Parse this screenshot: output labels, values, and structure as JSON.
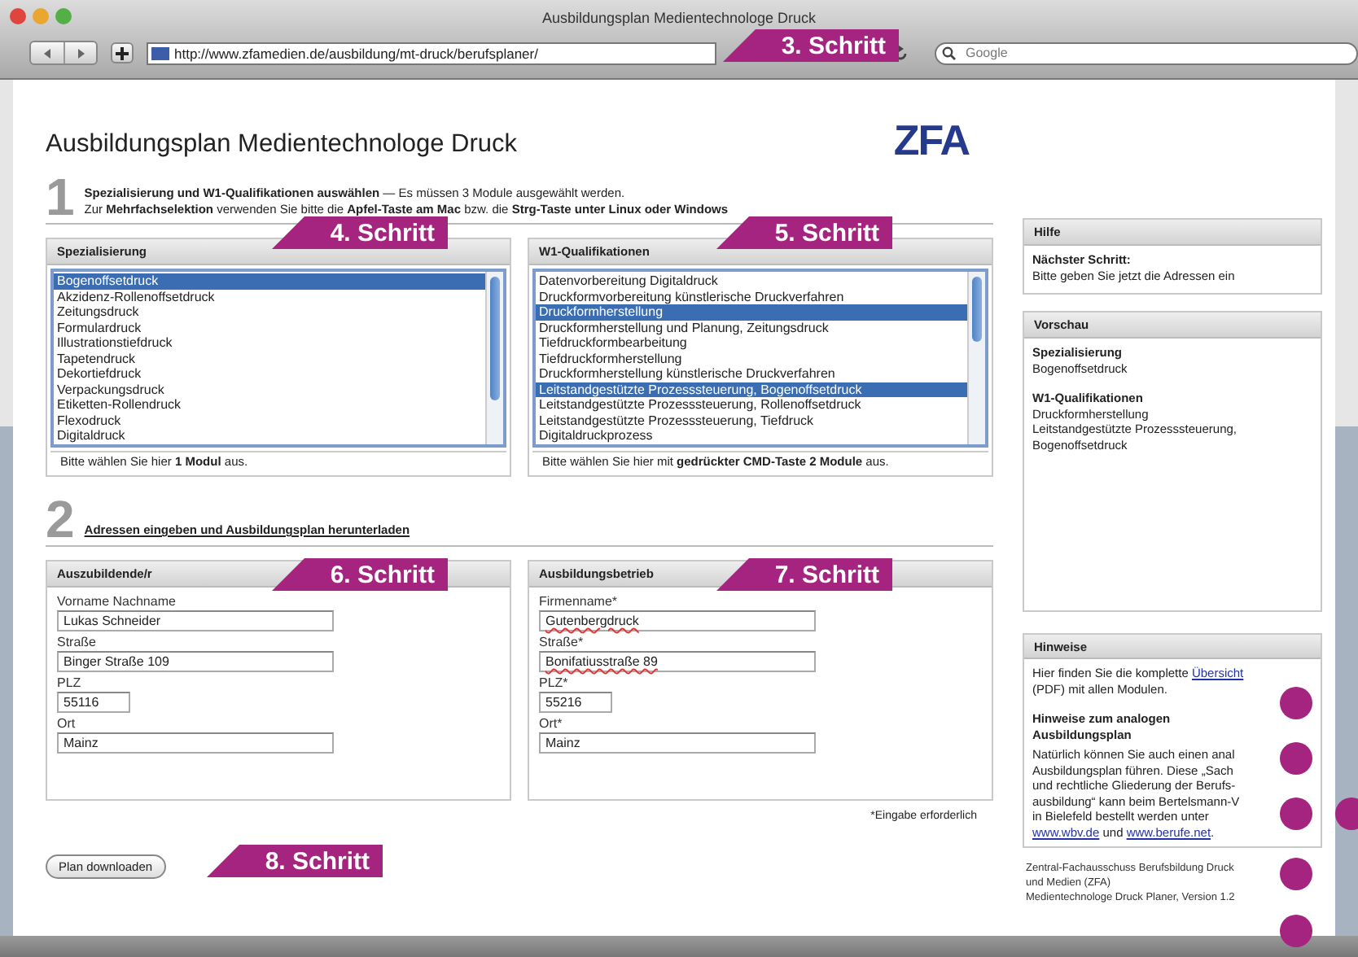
{
  "browser": {
    "title": "Ausbildungsplan Medientechnologe Druck",
    "url": "http://www.zfamedien.de/ausbildung/mt-druck/berufsplaner/",
    "search_placeholder": "Google"
  },
  "page": {
    "heading": "Ausbildungsplan Medientechnologe Druck",
    "logo": "ZFA"
  },
  "step1": {
    "number": "1",
    "intro": "**Spezialisierung und W1-Qualifikationen auswählen** — Es müssen 3 Module ausgewählt werden.",
    "hint": "Zur **Mehrfachselektion** verwenden Sie bitte die **Apfel-Taste am Mac** bzw. die **Strg-Taste unter Linux oder Windows**"
  },
  "lists": [
    {
      "title": "Spezialisierung",
      "note": "Bitte wählen Sie hier **1 Modul** aus.",
      "items": [
        {
          "label": "Bogenoffsetdruck",
          "selected": true
        },
        {
          "label": "Akzidenz-Rollenoffsetdruck",
          "selected": false
        },
        {
          "label": "Zeitungsdruck",
          "selected": false
        },
        {
          "label": "Formulardruck",
          "selected": false
        },
        {
          "label": "Illustrationstiefdruck",
          "selected": false
        },
        {
          "label": "Tapetendruck",
          "selected": false
        },
        {
          "label": "Dekortiefdruck",
          "selected": false
        },
        {
          "label": "Verpackungsdruck",
          "selected": false
        },
        {
          "label": "Etiketten-Rollendruck",
          "selected": false
        },
        {
          "label": "Flexodruck",
          "selected": false
        },
        {
          "label": "Digitaldruck",
          "selected": false
        }
      ]
    },
    {
      "title": "W1-Qualifikationen",
      "note": "Bitte wählen Sie hier mit **gedrückter CMD-Taste 2 Module** aus.",
      "items": [
        {
          "label": "Datenvorbereitung Digitaldruck",
          "selected": false
        },
        {
          "label": "Druckformvorbereitung künstlerische Druckverfahren",
          "selected": false
        },
        {
          "label": "Druckformherstellung",
          "selected": true
        },
        {
          "label": "Druckformherstellung und Planung, Zeitungsdruck",
          "selected": false
        },
        {
          "label": "Tiefdruckformbearbeitung",
          "selected": false
        },
        {
          "label": "Tiefdruckformherstellung",
          "selected": false
        },
        {
          "label": "Druckformherstellung künstlerische Druckverfahren",
          "selected": false
        },
        {
          "label": "Leitstandgestützte Prozesssteuerung, Bogenoffsetdruck",
          "selected": true
        },
        {
          "label": "Leitstandgestützte Prozesssteuerung, Rollenoffsetdruck",
          "selected": false
        },
        {
          "label": "Leitstandgestützte Prozesssteuerung, Tiefdruck",
          "selected": false
        },
        {
          "label": "Digitaldruckprozess",
          "selected": false
        }
      ]
    }
  ],
  "step2": {
    "number": "2",
    "heading": "Adressen eingeben und Ausbildungsplan herunterladen"
  },
  "address_panels": [
    {
      "title": "Auszubildende/r",
      "fields": [
        {
          "label": "Vorname Nachname",
          "value": "Lukas Schneider",
          "misspelled": false,
          "kind": "wide"
        },
        {
          "label": "Straße",
          "value": "Binger Straße 109",
          "misspelled": false,
          "kind": "wide"
        },
        {
          "label": "PLZ",
          "value": "55116",
          "misspelled": false,
          "kind": "short"
        },
        {
          "label": "Ort",
          "value": "Mainz",
          "misspelled": false,
          "kind": "wide"
        }
      ]
    },
    {
      "title": "Ausbildungsbetrieb",
      "fields": [
        {
          "label": "Firmenname*",
          "value": "Gutenbergdruck",
          "misspelled": true,
          "kind": "wide"
        },
        {
          "label": "Straße*",
          "value": "Bonifatiusstraße 89",
          "misspelled": true,
          "kind": "wide"
        },
        {
          "label": "PLZ*",
          "value": "55216",
          "misspelled": false,
          "kind": "short"
        },
        {
          "label": "Ort*",
          "value": "Mainz",
          "misspelled": false,
          "kind": "wide"
        }
      ]
    }
  ],
  "required_note": "*Eingabe erforderlich",
  "download_button": "Plan downloaden",
  "sidebar": {
    "help": {
      "title": "Hilfe",
      "subtitle": "Nächster Schritt:",
      "text": "Bitte geben Sie jetzt die Adressen ein"
    },
    "preview": {
      "title": "Vorschau",
      "sections": [
        {
          "heading": "Spezialisierung",
          "lines": [
            "Bogenoffsetdruck"
          ]
        },
        {
          "heading": "W1-Qualifikationen",
          "lines": [
            "Druckformherstellung",
            "Leitstandgestützte Prozesssteuerung, Bogenoffsetdruck"
          ]
        }
      ]
    },
    "notes": {
      "title": "Hinweise",
      "intro_before": "Hier finden Sie die komplette",
      "intro_link": "Übersicht",
      "intro_after": "(PDF) mit allen Modulen.",
      "subheading": "Hinweise zum analogen Ausbildungsplan",
      "lines": [
        "Natürlich können Sie auch einen anal",
        "Ausbildungsplan führen. Diese „Sach",
        "und rechtliche Gliederung der Berufs-",
        "ausbildung“ kann beim Bertelsmann-V",
        "in Bielefeld bestellt werden unter"
      ],
      "closing": [
        {
          "text": "www.wbv.de",
          "kind": "link"
        },
        {
          "text": " und ",
          "kind": "text"
        },
        {
          "text": "www.berufe.net",
          "kind": "link"
        },
        {
          "text": ".",
          "kind": "text"
        }
      ]
    },
    "footer": [
      "Zentral-Fachausschuss Berufsbildung Druck und Medien (ZFA)",
      "Medientechnologe Druck Planer, Version 1.2"
    ]
  },
  "step_tags": [
    {
      "label": "3. Schritt"
    },
    {
      "label": "4. Schritt"
    },
    {
      "label": "5. Schritt"
    },
    {
      "label": "6. Schritt"
    },
    {
      "label": "7. Schritt"
    },
    {
      "label": "8. Schritt"
    }
  ]
}
